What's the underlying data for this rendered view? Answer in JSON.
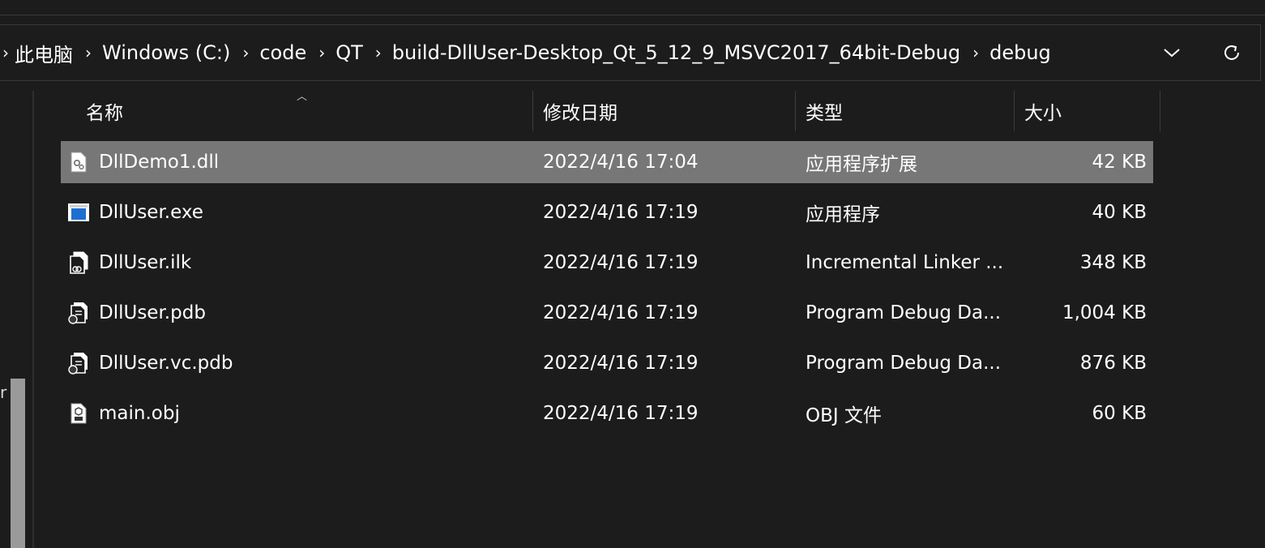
{
  "breadcrumb": {
    "items": [
      "此电脑",
      "Windows (C:)",
      "code",
      "QT",
      "build-DllUser-Desktop_Qt_5_12_9_MSVC2017_64bit-Debug",
      "debug"
    ],
    "separator": "›"
  },
  "columns": {
    "name": "名称",
    "date": "修改日期",
    "type": "类型",
    "size": "大小"
  },
  "files": [
    {
      "name": "DllDemo1.dll",
      "date": "2022/4/16 17:04",
      "type": "应用程序扩展",
      "size": "42 KB",
      "icon": "dll-file-icon",
      "selected": true
    },
    {
      "name": "DllUser.exe",
      "date": "2022/4/16 17:19",
      "type": "应用程序",
      "size": "40 KB",
      "icon": "exe-file-icon",
      "selected": false
    },
    {
      "name": "DllUser.ilk",
      "date": "2022/4/16 17:19",
      "type": "Incremental Linker ...",
      "size": "348 KB",
      "icon": "ilk-file-icon",
      "selected": false
    },
    {
      "name": "DllUser.pdb",
      "date": "2022/4/16 17:19",
      "type": "Program Debug Da...",
      "size": "1,004 KB",
      "icon": "pdb-file-icon",
      "selected": false
    },
    {
      "name": "DllUser.vc.pdb",
      "date": "2022/4/16 17:19",
      "type": "Program Debug Da...",
      "size": "876 KB",
      "icon": "pdb-file-icon",
      "selected": false
    },
    {
      "name": "main.obj",
      "date": "2022/4/16 17:19",
      "type": "OBJ 文件",
      "size": "60 KB",
      "icon": "obj-file-icon",
      "selected": false
    }
  ],
  "nav_fragment": "r",
  "colors": {
    "background": "#1c1c1c",
    "selected_row": "#777777",
    "text": "#ffffff",
    "exe_accent": "#1e6fd0"
  }
}
